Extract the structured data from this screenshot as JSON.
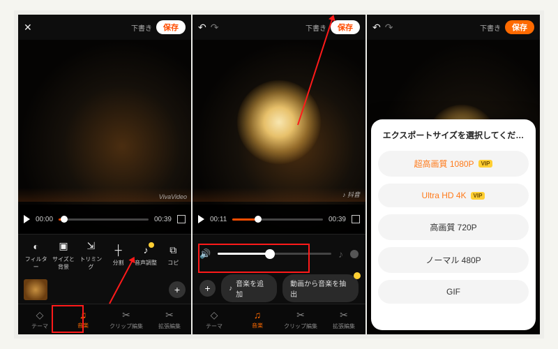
{
  "phone1": {
    "top": {
      "close": "✕",
      "draft": "下書き",
      "save": "保存"
    },
    "watermark": "VivaVideo",
    "play": {
      "t1": "00:00",
      "t2": "00:39"
    },
    "tools": {
      "filter": "フィルター",
      "size": "サイズと背景",
      "trim": "トリミング",
      "split": "分割",
      "audio": "音声調整",
      "more": "コピ"
    },
    "nav": {
      "theme": "テーマ",
      "music": "音楽",
      "cut": "クリップ編集",
      "extra": "拡張編集"
    }
  },
  "phone2": {
    "top": {
      "draft": "下書き",
      "save": "保存"
    },
    "play": {
      "t1": "00:11",
      "t2": "00:39"
    },
    "addMusic": "音楽を追加",
    "extract": "動画から音楽を抽出",
    "nav": {
      "theme": "テーマ",
      "music": "音楽",
      "cut": "クリップ編集",
      "extra": "拡張編集"
    }
  },
  "phone3": {
    "top": {
      "draft": "下書き",
      "save": "保存"
    },
    "sheet": {
      "title": "エクスポートサイズを選択してくだ…",
      "opt1": "超高画質 1080P",
      "opt2": "Ultra HD 4K",
      "opt3": "高画質 720P",
      "opt4": "ノーマル 480P",
      "opt5": "GIF",
      "vip": "VIP"
    }
  }
}
